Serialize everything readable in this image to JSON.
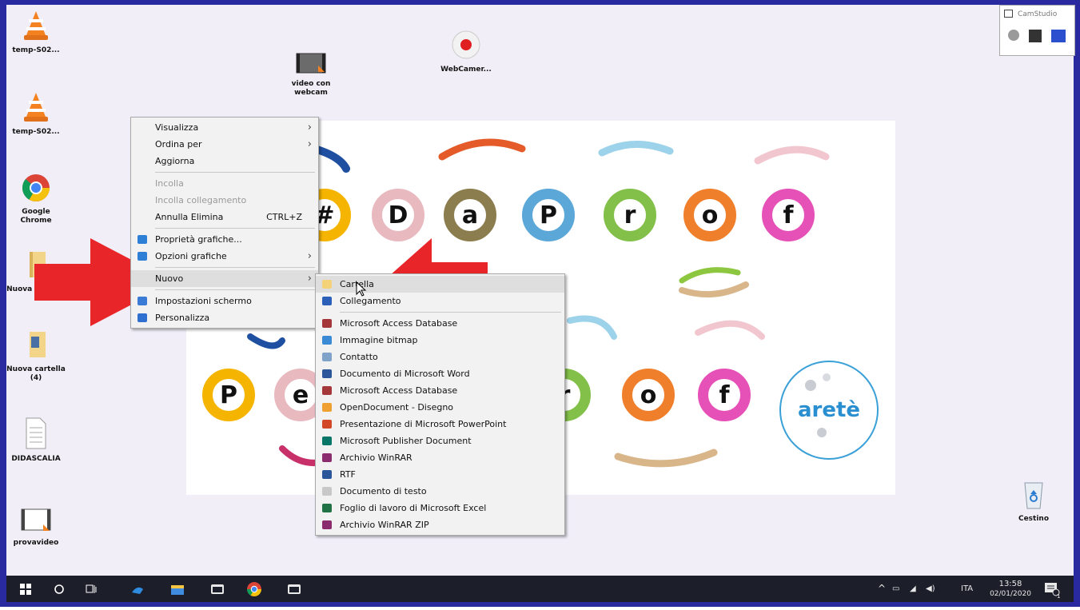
{
  "desktop_icons": [
    {
      "label": "temp-S02...",
      "icon": "vlc-icon"
    },
    {
      "label": "temp-S02...",
      "icon": "vlc-icon"
    },
    {
      "label": "Google Chrome",
      "icon": "chrome-icon"
    },
    {
      "label": "Nuova cartella",
      "icon": "folder-icon"
    },
    {
      "label": "Nuova cartella (4)",
      "icon": "folder-icon"
    },
    {
      "label": "DIDASCALIA",
      "icon": "document-icon"
    },
    {
      "label": "provavideo",
      "icon": "video-icon"
    },
    {
      "label": "video con webcam",
      "icon": "video-icon"
    },
    {
      "label": "WebCamer...",
      "icon": "record-icon"
    },
    {
      "label": "Cestino",
      "icon": "recycle-bin-icon"
    }
  ],
  "banner": {
    "row1": [
      "#",
      "D",
      "a",
      "P",
      "r",
      "o",
      "f"
    ],
    "row2": [
      "P",
      "e",
      "",
      "r",
      "o",
      "f"
    ],
    "logo": "aretè",
    "colors": [
      "#f5b400",
      "#e9b9c0",
      "#8b7d4d",
      "#5aa7d8",
      "#83c04a",
      "#f07f2b",
      "#e551b7"
    ]
  },
  "context_menu": {
    "items": [
      {
        "label": "Visualizza",
        "submenu": true
      },
      {
        "label": "Ordina per",
        "submenu": true
      },
      {
        "label": "Aggiorna"
      },
      {
        "separator": true
      },
      {
        "label": "Incolla",
        "disabled": true
      },
      {
        "label": "Incolla collegamento",
        "disabled": true
      },
      {
        "label": "Annulla Elimina",
        "shortcut": "CTRL+Z"
      },
      {
        "separator": true
      },
      {
        "label": "Proprietà grafiche...",
        "icon": "graphics-icon"
      },
      {
        "label": "Opzioni grafiche",
        "icon": "graphics-icon",
        "submenu": true
      },
      {
        "separator": true
      },
      {
        "label": "Nuovo",
        "submenu": true,
        "highlighted": true
      },
      {
        "separator": true
      },
      {
        "label": "Impostazioni schermo",
        "icon": "display-icon"
      },
      {
        "label": "Personalizza",
        "icon": "personalize-icon"
      }
    ]
  },
  "new_submenu": {
    "items": [
      {
        "label": "Cartella",
        "icon": "folder-icon",
        "highlighted": true
      },
      {
        "label": "Collegamento",
        "icon": "shortcut-icon"
      },
      {
        "separator": true
      },
      {
        "label": "Microsoft Access Database",
        "icon": "access-icon"
      },
      {
        "label": "Immagine bitmap",
        "icon": "bitmap-icon"
      },
      {
        "label": "Contatto",
        "icon": "contact-icon"
      },
      {
        "label": "Documento di Microsoft Word",
        "icon": "word-icon"
      },
      {
        "label": "Microsoft Access Database",
        "icon": "access-icon"
      },
      {
        "label": "OpenDocument - Disegno",
        "icon": "odg-icon"
      },
      {
        "label": "Presentazione di Microsoft PowerPoint",
        "icon": "powerpoint-icon"
      },
      {
        "label": "Microsoft Publisher Document",
        "icon": "publisher-icon"
      },
      {
        "label": "Archivio WinRAR",
        "icon": "winrar-icon"
      },
      {
        "label": "RTF",
        "icon": "rtf-icon"
      },
      {
        "label": "Documento di testo",
        "icon": "text-icon"
      },
      {
        "label": "Foglio di lavoro di Microsoft Excel",
        "icon": "excel-icon"
      },
      {
        "label": "Archivio WinRAR ZIP",
        "icon": "winrar-icon"
      }
    ]
  },
  "camstudio": {
    "title": "CamStudio"
  },
  "taskbar": {
    "apps": [
      "windows-start-icon",
      "search-icon",
      "task-view-icon",
      "app-icon",
      "file-explorer-icon",
      "window-icon",
      "chrome-icon",
      "window-icon"
    ],
    "tray_language": "ITA",
    "time": "13:58",
    "date": "02/01/2020",
    "notification_count": "1"
  },
  "colors": {
    "desktop_bg": "#f1eef8",
    "frame": "#2a2aa0",
    "arrow": "#e8262a",
    "taskbar": "#1c1f2a"
  }
}
